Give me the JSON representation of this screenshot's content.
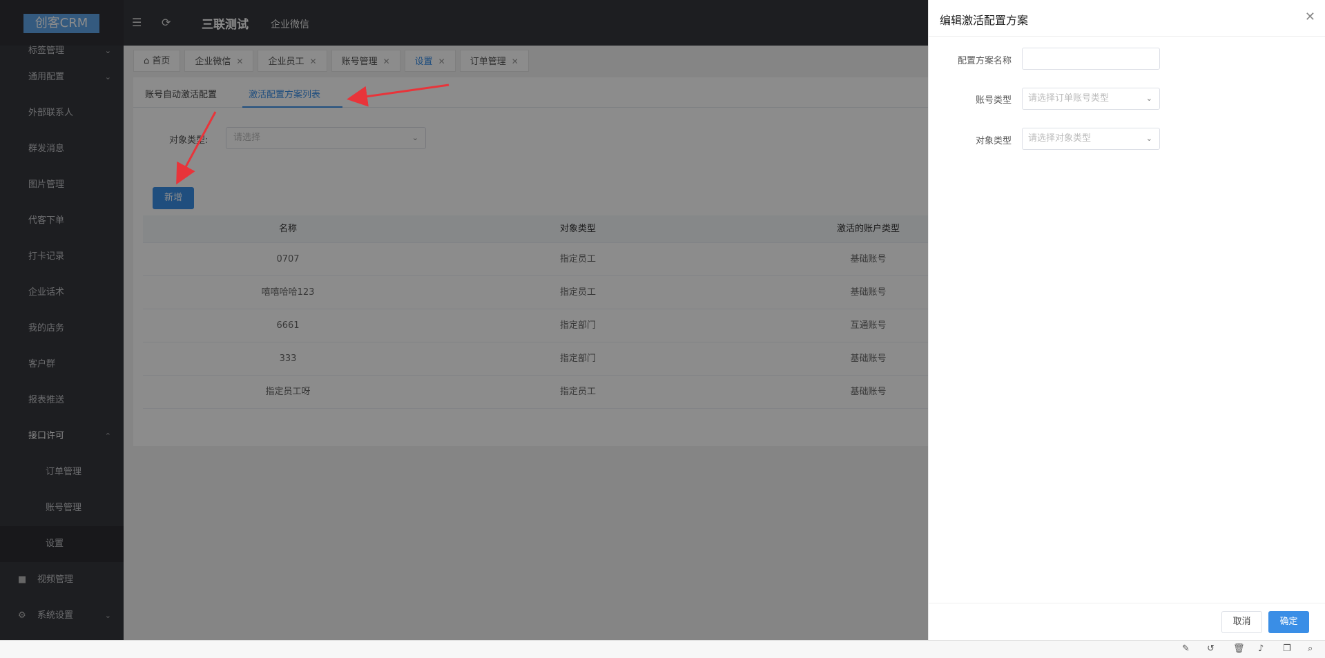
{
  "logo": "创客CRM",
  "header": {
    "brand": "三联测试",
    "nav_item": "企业微信"
  },
  "sidebar": {
    "partial_label": "标签管理",
    "items": [
      {
        "label": "通用配置",
        "chevron": "chevron-down-icon"
      },
      {
        "label": "外部联系人"
      },
      {
        "label": "群发消息"
      },
      {
        "label": "图片管理"
      },
      {
        "label": "代客下单"
      },
      {
        "label": "打卡记录"
      },
      {
        "label": "企业话术"
      },
      {
        "label": "我的店务"
      },
      {
        "label": "客户群"
      },
      {
        "label": "报表推送"
      },
      {
        "label": "接口许可",
        "chevron": "chevron-up-icon"
      }
    ],
    "sub_items": [
      "订单管理",
      "账号管理",
      "设置"
    ],
    "bottom_items": [
      {
        "label": "视频管理",
        "icon": "video-icon"
      },
      {
        "label": "系统设置",
        "icon": "gear-icon"
      }
    ]
  },
  "tabs": [
    {
      "label": "首页"
    },
    {
      "label": "企业微信"
    },
    {
      "label": "企业员工"
    },
    {
      "label": "账号管理"
    },
    {
      "label": "设置"
    },
    {
      "label": "订单管理"
    }
  ],
  "subtabs": [
    "账号自动激活配置",
    "激活配置方案列表"
  ],
  "filter": {
    "label": "对象类型:",
    "placeholder": "请选择"
  },
  "add_button": "新增",
  "table": {
    "headers": [
      "名称",
      "对象类型",
      "激活的账户类型"
    ],
    "rows": [
      [
        "0707",
        "指定员工",
        "基础账号"
      ],
      [
        "嘻嘻哈哈123",
        "指定员工",
        "基础账号"
      ],
      [
        "6661",
        "指定部门",
        "互通账号"
      ],
      [
        "333",
        "指定部门",
        "基础账号"
      ],
      [
        "指定员工呀",
        "指定员工",
        "基础账号"
      ]
    ]
  },
  "drawer": {
    "title": "编辑激活配置方案",
    "fields": [
      {
        "label": "配置方案名称",
        "value": ""
      },
      {
        "label": "账号类型",
        "placeholder": "请选择订单账号类型"
      },
      {
        "label": "对象类型",
        "placeholder": "请选择对象类型"
      }
    ],
    "cancel": "取消",
    "confirm": "确定"
  },
  "colors": {
    "primary": "#3a8ee6",
    "sidebar": "#36373c",
    "annotation": "#e8343a"
  }
}
